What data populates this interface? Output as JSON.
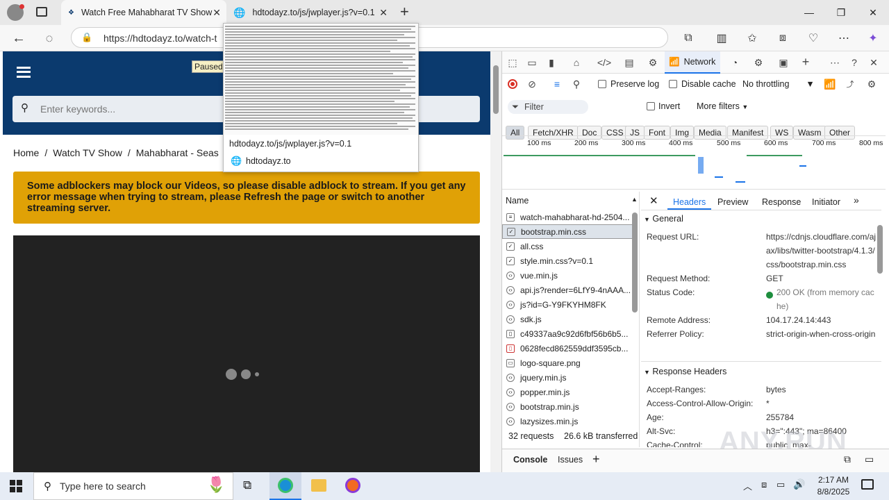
{
  "browser": {
    "tabs": [
      {
        "title": "Watch Free Mahabharat TV Show"
      },
      {
        "title": "hdtodayz.to/js/jwplayer.js?v=0.1"
      }
    ],
    "address_bar": {
      "url": "https://hdtodayz.to/watch-t"
    },
    "tab_preview": {
      "title": "hdtodayz.to/js/jwplayer.js?v=0.1",
      "site": "hdtodayz.to"
    }
  },
  "page": {
    "paused_label": "Paused",
    "search_placeholder": "Enter keywords...",
    "breadcrumb": [
      "Home",
      "/",
      "Watch TV Show",
      "/",
      "Mahabharat - Seas"
    ],
    "notice": "Some adblockers may block our Videos, so please disable adblock to stream. If you get any error message when trying to stream, please Refresh the page or switch to another streaming server."
  },
  "devtools": {
    "active_panel": "Network",
    "preserve_log": "Preserve log",
    "disable_cache": "Disable cache",
    "throttling": "No throttling",
    "filter_placeholder": "Filter",
    "invert": "Invert",
    "more_filters": "More filters",
    "type_filters": [
      "All",
      "Fetch/XHR",
      "Doc",
      "CSS",
      "JS",
      "Font",
      "Img",
      "Media",
      "Manifest",
      "WS",
      "Wasm",
      "Other"
    ],
    "timeline_ticks": [
      "100 ms",
      "200 ms",
      "300 ms",
      "400 ms",
      "500 ms",
      "600 ms",
      "700 ms",
      "800 ms"
    ],
    "name_header": "Name",
    "requests": [
      "watch-mahabharat-hd-2504...",
      "bootstrap.min.css",
      "all.css",
      "style.min.css?v=0.1",
      "vue.min.js",
      "api.js?render=6LfY9-4nAAA...",
      "js?id=G-Y9FKYHM8FK",
      "sdk.js",
      "c49337aa9c92d6fbf56b6b5...",
      "0628fecd862559ddf3595cb...",
      "logo-square.png",
      "jquery.min.js",
      "popper.min.js",
      "bootstrap.min.js",
      "lazysizes.min.js"
    ],
    "summary": {
      "requests": "32 requests",
      "transferred": "26.6 kB transferred"
    },
    "detail_tabs": [
      "Headers",
      "Preview",
      "Response",
      "Initiator"
    ],
    "general": {
      "title": "General",
      "rows": [
        {
          "k": "Request URL:",
          "v": "https://cdnjs.cloudflare.com/ajax/libs/twitter-bootstrap/4.1.3/css/bootstrap.min.css"
        },
        {
          "k": "Request Method:",
          "v": "GET"
        },
        {
          "k": "Status Code:",
          "v": "200 OK (from memory cache)"
        },
        {
          "k": "Remote Address:",
          "v": "104.17.24.14:443"
        },
        {
          "k": "Referrer Policy:",
          "v": "strict-origin-when-cross-origin"
        }
      ]
    },
    "response_headers": {
      "title": "Response Headers",
      "rows": [
        {
          "k": "Accept-Ranges:",
          "v": "bytes"
        },
        {
          "k": "Access-Control-Allow-Origin:",
          "v": "*"
        },
        {
          "k": "Age:",
          "v": "255784"
        },
        {
          "k": "Alt-Svc:",
          "v": "h3=\":443\"; ma=86400"
        },
        {
          "k": "Cache-Control:",
          "v": "public, max-"
        }
      ]
    },
    "drawer_tabs": [
      "Console",
      "Issues"
    ]
  },
  "taskbar": {
    "search_placeholder": "Type here to search",
    "time": "2:17 AM",
    "date": "8/8/2025"
  },
  "watermark": "ANY.RUN",
  "colors": {
    "header_bg": "#0b3a6e",
    "notice_bg": "#e0a106",
    "accent_blue": "#1a73e8",
    "status_green": "#1e8e3e"
  }
}
